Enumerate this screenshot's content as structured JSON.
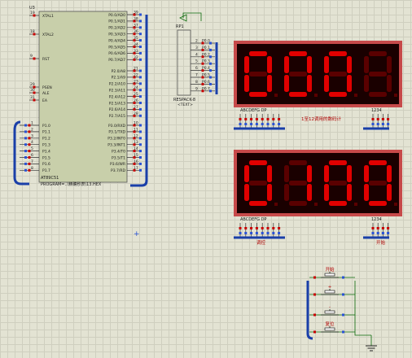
{
  "colors": {
    "background": "#e3e3d3",
    "grid": "#cfcfbf",
    "ic_body": "#c8cfaa",
    "bus": "#1a3fa8",
    "display_frame": "#c74a4a",
    "display_face": "#1a0000",
    "segment_on": "#e10000",
    "segment_off": "#5a0000",
    "pin_red": "#c80000",
    "pin_blue": "#2a52d4",
    "wire_green": "#0a6a0a"
  },
  "mcu": {
    "ref": "U3",
    "part": "AT89C51",
    "program": "PROGRAM=..\\精确秒表\\13.HEX",
    "left_pins": [
      {
        "num": "19",
        "name": "XTAL1"
      },
      {
        "num": "18",
        "name": "XTAL2"
      },
      {
        "num": "9",
        "name": "RST"
      },
      {
        "num": "29",
        "name": "PSEN"
      },
      {
        "num": "30",
        "name": "ALE"
      },
      {
        "num": "31",
        "name": "EA"
      }
    ],
    "p1_pins": [
      {
        "num": "1",
        "name": "P1.0"
      },
      {
        "num": "2",
        "name": "P1.1"
      },
      {
        "num": "3",
        "name": "P1.2"
      },
      {
        "num": "4",
        "name": "P1.3"
      },
      {
        "num": "5",
        "name": "P1.4"
      },
      {
        "num": "6",
        "name": "P1.5"
      },
      {
        "num": "7",
        "name": "P1.6"
      },
      {
        "num": "8",
        "name": "P1.7"
      }
    ],
    "p0_pins": [
      "P0.0/AD0",
      "P0.1/AD1",
      "P0.2/AD2",
      "P0.3/AD3",
      "P0.4/AD4",
      "P0.5/AD5",
      "P0.6/AD6",
      "P0.7/AD7"
    ],
    "p2_pins": [
      "P2.0/A8",
      "P2.1/A9",
      "P2.2/A10",
      "P2.3/A11",
      "P2.4/A12",
      "P2.5/A13",
      "P2.6/A14",
      "P2.7/A15"
    ],
    "p3_pins": [
      "P3.0/RXD",
      "P3.1/TXD",
      "P3.2/INT0",
      "P3.3/INT1",
      "P3.4/T0",
      "P3.5/T1",
      "P3.6/WR",
      "P3.7/RD"
    ],
    "p0_nums": [
      "39",
      "38",
      "37",
      "36",
      "35",
      "34",
      "33",
      "32"
    ],
    "p2_nums": [
      "21",
      "22",
      "23",
      "24",
      "25",
      "26",
      "27",
      "28"
    ],
    "p3_nums": [
      "10",
      "11",
      "12",
      "13",
      "14",
      "15",
      "16",
      "17"
    ]
  },
  "rp1": {
    "ref": "RP1",
    "part": "RESPACK-8",
    "text": "<TEXT>",
    "pins": [
      "P0.0",
      "P0.1",
      "P0.2",
      "P0.3",
      "P0.4",
      "P0.5",
      "P0.6",
      "P0.7"
    ]
  },
  "display_top": {
    "digits": [
      "0",
      "0",
      "0",
      "blank"
    ],
    "seg_label": "ABCDEFG DP",
    "com_label": "1234",
    "caption": "1至12调用的数码计"
  },
  "display_bottom": {
    "digits": [
      "0",
      "1",
      "0",
      "0"
    ],
    "seg_label": "ABCDEFG DP",
    "com_label": "1234",
    "caption_left": "调控",
    "caption_right": "开始"
  },
  "buttons": {
    "labels": [
      "开始",
      "+",
      "-",
      "复位"
    ]
  },
  "marker": {
    "symbol": "+"
  }
}
